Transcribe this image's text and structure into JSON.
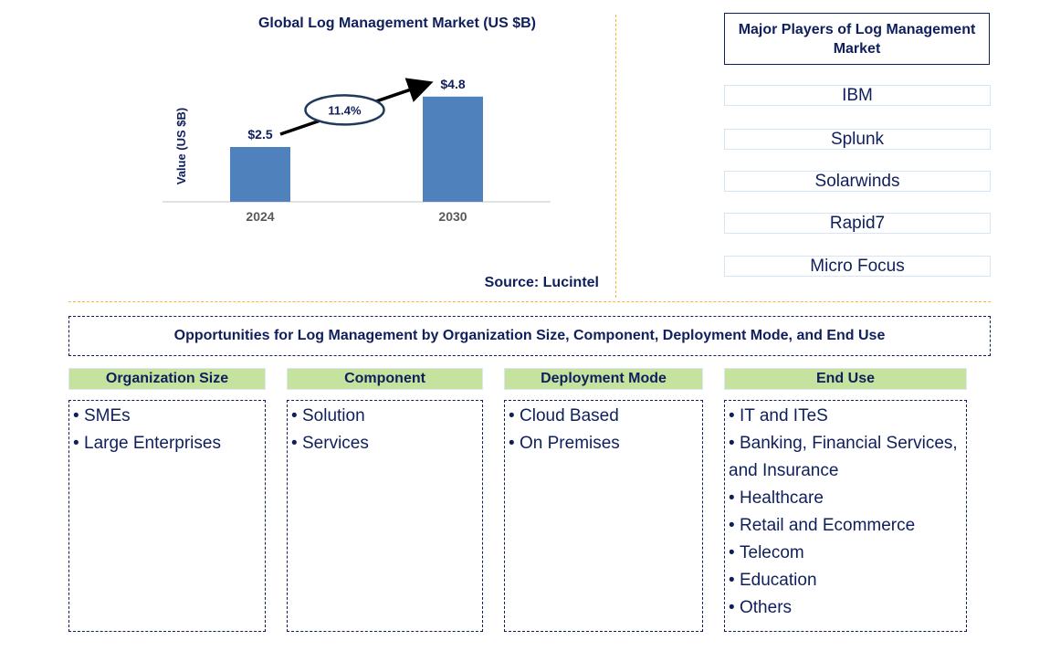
{
  "chart_data": {
    "type": "bar",
    "title": "Global Log Management Market (US $B)",
    "categories": [
      "2024",
      "2030"
    ],
    "values": [
      2.5,
      4.8
    ],
    "data_labels": [
      "$2.5",
      "$4.8"
    ],
    "xlabel": "",
    "ylabel": "Value (US $B)",
    "ylim": [
      0,
      6
    ],
    "grid": false,
    "bar_color": "#4f81bd",
    "annotation": {
      "type": "cagr-arrow",
      "label": "11.4%",
      "from": "2024",
      "to": "2030"
    },
    "source": "Source: Lucintel"
  },
  "players": {
    "title": "Major Players of Log Management Market",
    "items": [
      "IBM",
      "Splunk",
      "Solarwinds",
      "Rapid7",
      "Micro Focus"
    ]
  },
  "opportunities": {
    "title": "Opportunities for Log Management by Organization Size, Component, Deployment Mode, and End Use",
    "categories": [
      {
        "name": "Organization Size",
        "items": [
          "SMEs",
          "Large Enterprises"
        ]
      },
      {
        "name": "Component",
        "items": [
          "Solution",
          "Services"
        ]
      },
      {
        "name": "Deployment Mode",
        "items": [
          "Cloud Based",
          "On Premises"
        ]
      },
      {
        "name": "End Use",
        "items": [
          "IT and ITeS",
          "Banking, Financial Services, and Insurance",
          "Healthcare",
          "Retail and Ecommerce",
          "Telecom",
          "Education",
          "Others"
        ]
      }
    ]
  },
  "colors": {
    "text": "#0f1f5c",
    "bar": "#4f81bd",
    "category_header": "#c5e39f",
    "divider": "#f5b82e",
    "player_border": "#d4e6f5"
  }
}
